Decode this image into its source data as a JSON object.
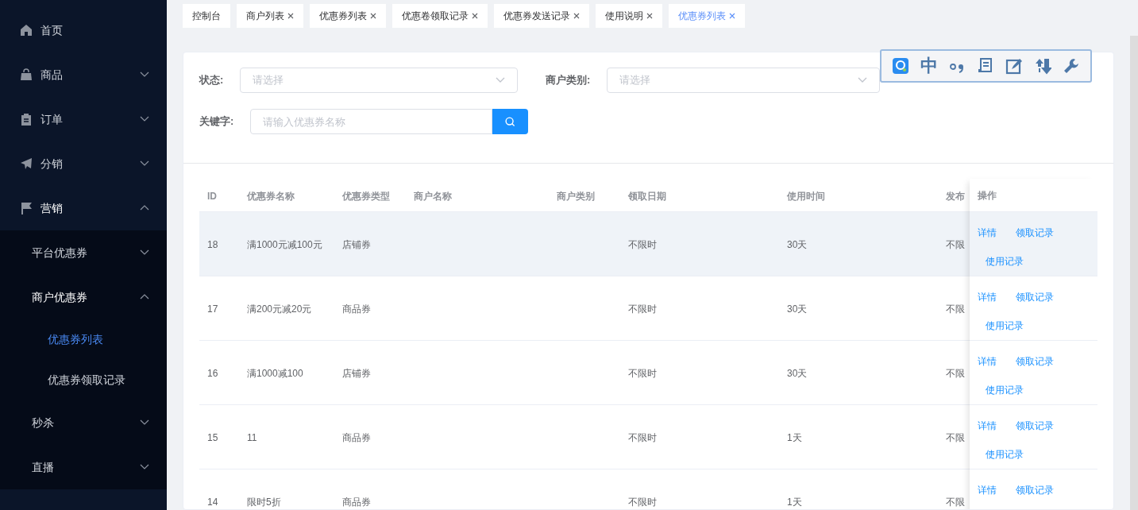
{
  "sidebar": {
    "items": [
      {
        "label": "首页"
      },
      {
        "label": "商品",
        "expanded": false
      },
      {
        "label": "订单",
        "expanded": false
      },
      {
        "label": "分销",
        "expanded": false
      },
      {
        "label": "营销",
        "expanded": true,
        "children": [
          {
            "label": "平台优惠券",
            "expanded": false
          },
          {
            "label": "商户优惠券",
            "expanded": true,
            "children": [
              {
                "label": "优惠券列表",
                "selected": true
              },
              {
                "label": "优惠券领取记录",
                "selected": false
              }
            ]
          },
          {
            "label": "秒杀",
            "expanded": false
          },
          {
            "label": "直播",
            "expanded": false
          }
        ]
      }
    ]
  },
  "tabs": [
    {
      "label": "控制台",
      "closable": false,
      "selected": false
    },
    {
      "label": "商户列表",
      "closable": true,
      "selected": false
    },
    {
      "label": "优惠券列表",
      "closable": true,
      "selected": false
    },
    {
      "label": "优惠卷领取记录",
      "closable": true,
      "selected": false
    },
    {
      "label": "优惠券发送记录",
      "closable": true,
      "selected": false
    },
    {
      "label": "使用说明",
      "closable": true,
      "selected": false
    },
    {
      "label": "优惠券列表",
      "closable": true,
      "selected": true
    }
  ],
  "filters": {
    "status": {
      "label": "状态:",
      "placeholder": "请选择"
    },
    "merchant_type": {
      "label": "商户类别:",
      "placeholder": "请选择"
    },
    "keyword": {
      "label": "关键字:",
      "placeholder": "请输入优惠券名称"
    }
  },
  "table": {
    "columns": [
      "ID",
      "优惠券名称",
      "优惠券类型",
      "商户名称",
      "商户类别",
      "领取日期",
      "使用时间",
      "发布"
    ],
    "action_column": "操作",
    "rows": [
      {
        "cells": [
          "18",
          "满1000元减100元",
          "店铺券",
          "",
          "",
          "不限时",
          "30天",
          "不限"
        ],
        "hovered": true,
        "actions": [
          "详情",
          "领取记录",
          "使用记录"
        ]
      },
      {
        "cells": [
          "17",
          "满200元减20元",
          "商品券",
          "",
          "",
          "不限时",
          "30天",
          "不限"
        ],
        "hovered": false,
        "actions": [
          "详情",
          "领取记录",
          "使用记录"
        ]
      },
      {
        "cells": [
          "16",
          "满1000减100",
          "店铺券",
          "",
          "",
          "不限时",
          "30天",
          "不限"
        ],
        "hovered": false,
        "actions": [
          "详情",
          "领取记录",
          "使用记录"
        ]
      },
      {
        "cells": [
          "15",
          "11",
          "商品券",
          "",
          "",
          "不限时",
          "1天",
          "不限"
        ],
        "hovered": false,
        "actions": [
          "详情",
          "领取记录",
          "使用记录"
        ]
      },
      {
        "cells": [
          "14",
          "限时5折",
          "商品券",
          "",
          "",
          "不限时",
          "1天",
          "不限"
        ],
        "hovered": false,
        "actions": [
          "详情",
          "领取记录"
        ]
      }
    ]
  },
  "ime_toolbar": {
    "items": [
      {
        "kind": "logo"
      },
      {
        "kind": "text",
        "text": "中"
      },
      {
        "kind": "punct"
      },
      {
        "kind": "doc"
      },
      {
        "kind": "edit"
      },
      {
        "kind": "sort"
      },
      {
        "kind": "wrench"
      }
    ]
  }
}
